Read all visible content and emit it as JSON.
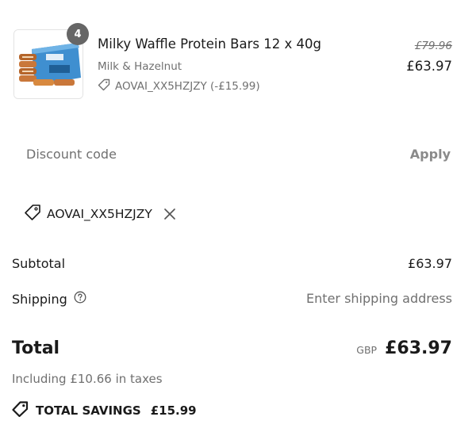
{
  "product": {
    "name": "Milky Waffle Protein Bars 12 x 40g",
    "variant": "Milk & Hazelnut",
    "quantity": "4",
    "discount_line": "AOVAI_XX5HZJZY (-£15.99)",
    "original_price": "£79.96",
    "price": "£63.97",
    "thumbnail_icon": "protein-bars-box-image"
  },
  "discount": {
    "placeholder": "Discount code",
    "value": "",
    "apply_label": "Apply",
    "applied_code": "AOVAI_XX5HZJZY"
  },
  "summary": {
    "subtotal_label": "Subtotal",
    "subtotal_value": "£63.97",
    "shipping_label": "Shipping",
    "shipping_value": "Enter shipping address",
    "total_label": "Total",
    "currency": "GBP",
    "total_value": "£63.97",
    "tax_note": "Including £10.66 in taxes",
    "savings_label": "TOTAL SAVINGS",
    "savings_value": "£15.99"
  },
  "colors": {
    "text": "#1a1a1a",
    "muted": "#707070",
    "badge": "#666666",
    "apply_disabled": "#8a8a8a"
  }
}
